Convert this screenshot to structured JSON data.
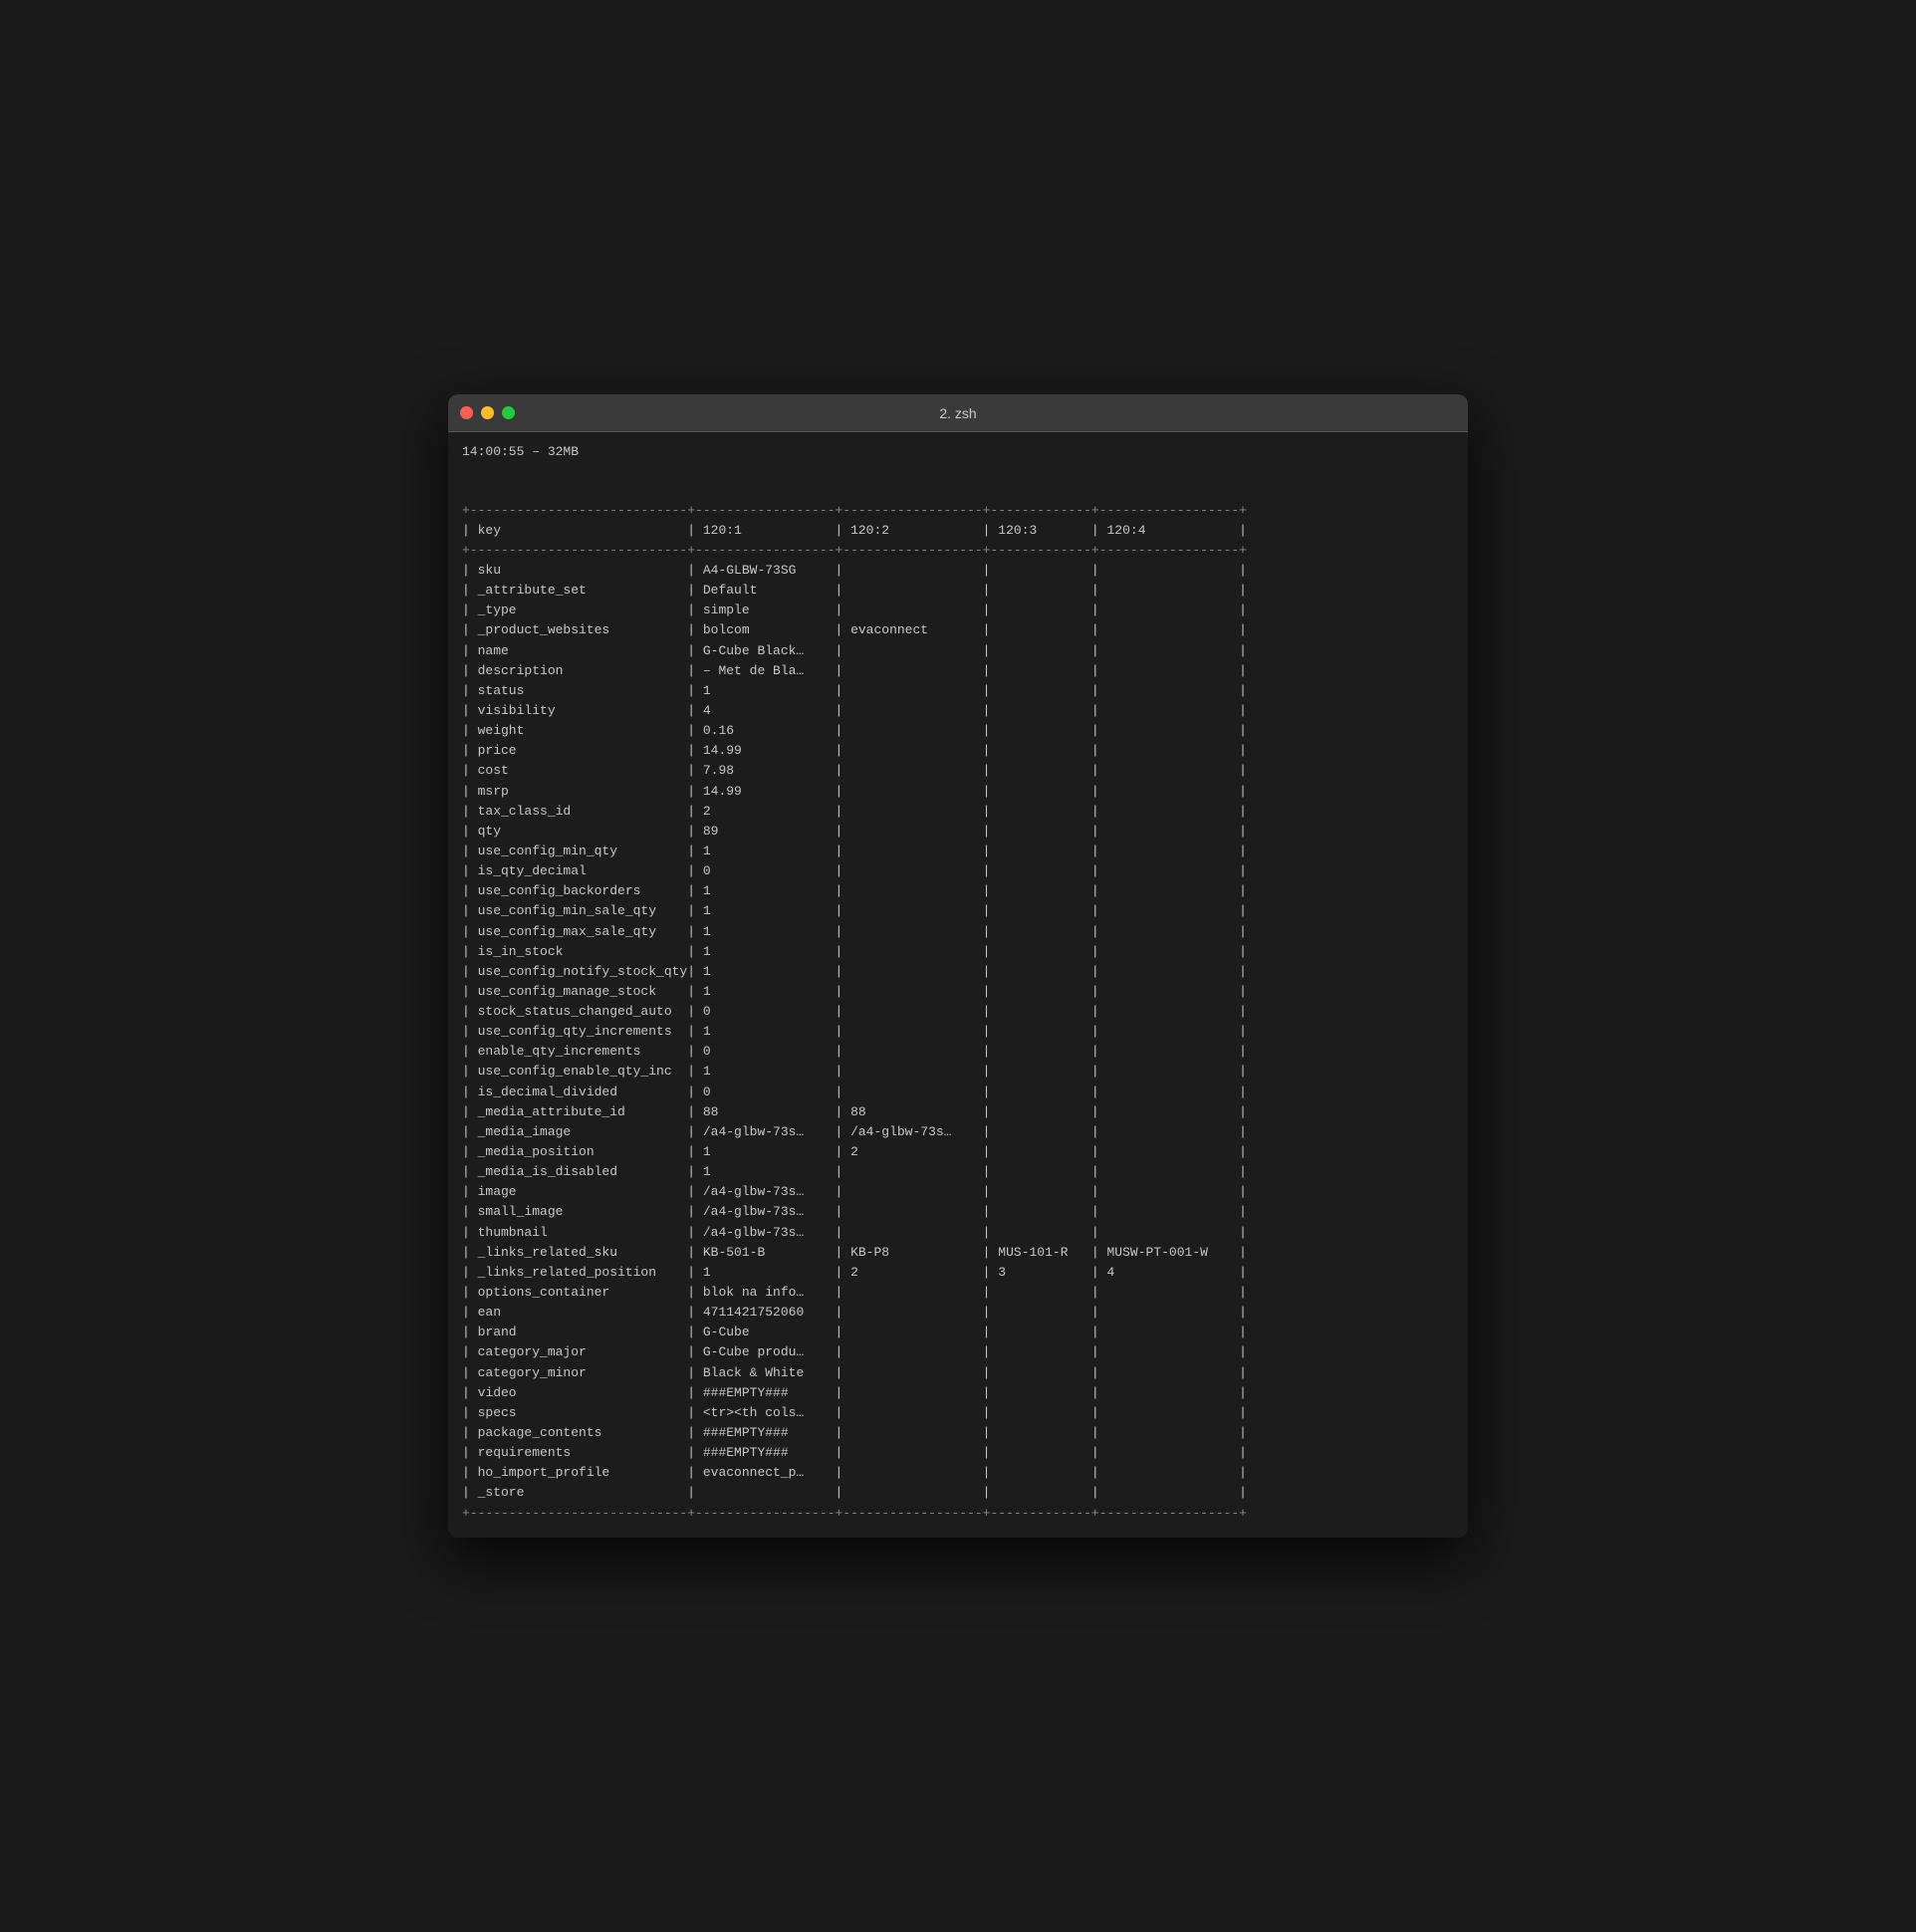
{
  "window": {
    "title": "2. zsh",
    "status": "14:00:55 – 32MB"
  },
  "table": {
    "separator_top": "+----------------------------+------------------+------------------+-------------+------------------+",
    "header": "| key                        | 120:1            | 120:2            | 120:3       | 120:4            |",
    "separator_mid": "+----------------------------+------------------+------------------+-------------+------------------+",
    "separator_bot": "+----------------------------+------------------+------------------+-------------+------------------+",
    "rows": [
      "| sku                        | A4-GLBW-73SG     |                  |             |                  |",
      "| _attribute_set             | Default          |                  |             |                  |",
      "| _type                      | simple           |                  |             |                  |",
      "| _product_websites          | bolcom           | evaconnect       |             |                  |",
      "| name                       | G-Cube Black…    |                  |             |                  |",
      "| description                | – Met de Bla…    |                  |             |                  |",
      "| status                     | 1                |                  |             |                  |",
      "| visibility                 | 4                |                  |             |                  |",
      "| weight                     | 0.16             |                  |             |                  |",
      "| price                      | 14.99            |                  |             |                  |",
      "| cost                       | 7.98             |                  |             |                  |",
      "| msrp                       | 14.99            |                  |             |                  |",
      "| tax_class_id               | 2                |                  |             |                  |",
      "| qty                        | 89               |                  |             |                  |",
      "| use_config_min_qty         | 1                |                  |             |                  |",
      "| is_qty_decimal             | 0                |                  |             |                  |",
      "| use_config_backorders      | 1                |                  |             |                  |",
      "| use_config_min_sale_qty    | 1                |                  |             |                  |",
      "| use_config_max_sale_qty    | 1                |                  |             |                  |",
      "| is_in_stock                | 1                |                  |             |                  |",
      "| use_config_notify_stock_qty| 1                |                  |             |                  |",
      "| use_config_manage_stock    | 1                |                  |             |                  |",
      "| stock_status_changed_auto  | 0                |                  |             |                  |",
      "| use_config_qty_increments  | 1                |                  |             |                  |",
      "| enable_qty_increments      | 0                |                  |             |                  |",
      "| use_config_enable_qty_inc  | 1                |                  |             |                  |",
      "| is_decimal_divided         | 0                |                  |             |                  |",
      "| _media_attribute_id        | 88               | 88               |             |                  |",
      "| _media_image               | /a4-glbw-73s…    | /a4-glbw-73s…    |             |                  |",
      "| _media_position            | 1                | 2                |             |                  |",
      "| _media_is_disabled         | 1                |                  |             |                  |",
      "| image                      | /a4-glbw-73s…    |                  |             |                  |",
      "| small_image                | /a4-glbw-73s…    |                  |             |                  |",
      "| thumbnail                  | /a4-glbw-73s…    |                  |             |                  |",
      "| _links_related_sku         | KB-501-B         | KB-P8            | MUS-101-R   | MUSW-PT-001-W    |",
      "| _links_related_position    | 1                | 2                | 3           | 4                |",
      "| options_container          | blok na info…    |                  |             |                  |",
      "| ean                        | 4711421752060    |                  |             |                  |",
      "| brand                      | G-Cube           |                  |             |                  |",
      "| category_major             | G-Cube produ…    |                  |             |                  |",
      "| category_minor             | Black & White    |                  |             |                  |",
      "| video                      | ###EMPTY###      |                  |             |                  |",
      "| specs                      | <tr><th cols…    |                  |             |                  |",
      "| package_contents           | ###EMPTY###      |                  |             |                  |",
      "| requirements               | ###EMPTY###      |                  |             |                  |",
      "| ho_import_profile          | evaconnect_p…    |                  |             |                  |",
      "| _store                     |                  |                  |             |                  |"
    ]
  }
}
